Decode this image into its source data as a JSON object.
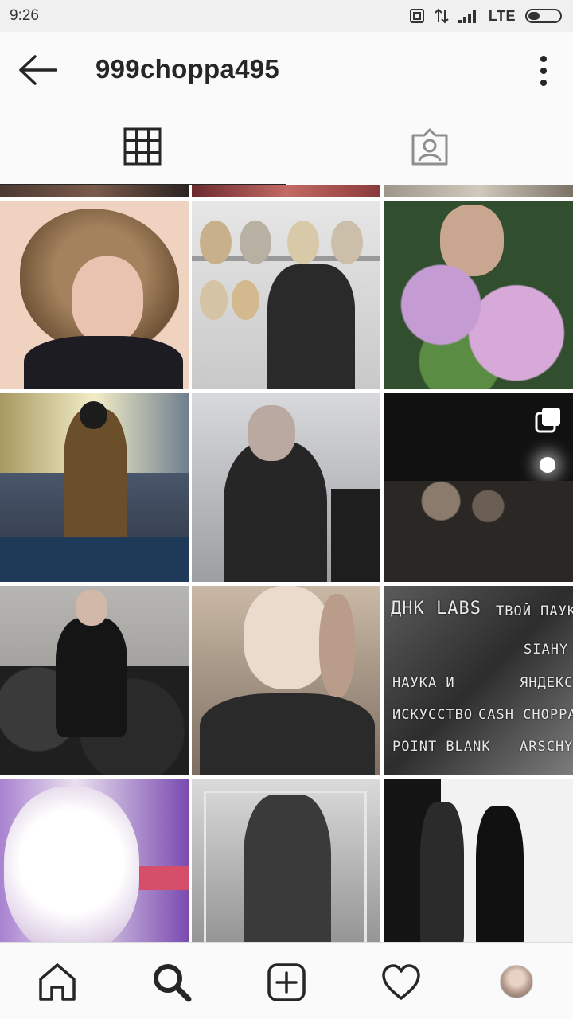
{
  "status_bar": {
    "time": "9:26",
    "network": "LTE",
    "icons": [
      "nfc-icon",
      "data-transfer-icon",
      "signal-icon",
      "battery-icon"
    ]
  },
  "header": {
    "title": "999choppa495",
    "back_icon": "arrow-left-icon",
    "more_icon": "more-vertical-icon"
  },
  "tabs": [
    {
      "icon": "grid-icon",
      "active": true
    },
    {
      "icon": "tagged-person-icon",
      "active": false
    }
  ],
  "posts": [
    {
      "row": 1,
      "col": 1,
      "scene": "portrait-messy-hair",
      "colors": [
        "#efd2c0",
        "#7a5a3c",
        "#1c1c22"
      ]
    },
    {
      "row": 1,
      "col": 2,
      "scene": "wig-store",
      "colors": [
        "#dcdcdc",
        "#a7a7a7",
        "#2a2a2a"
      ]
    },
    {
      "row": 1,
      "col": 3,
      "scene": "lilac-blur",
      "colors": [
        "#314e2e",
        "#b78bc3",
        "#7f6c5a"
      ]
    },
    {
      "row": 2,
      "col": 1,
      "scene": "masked-street",
      "colors": [
        "#3b4f6b",
        "#6a4f2a",
        "#a79960"
      ]
    },
    {
      "row": 2,
      "col": 2,
      "scene": "performer-smoke",
      "colors": [
        "#cfd0d3",
        "#585858",
        "#1e1e1e"
      ]
    },
    {
      "row": 2,
      "col": 3,
      "scene": "dark-crowd",
      "colors": [
        "#111111",
        "#3d3b3a",
        "#8a7b6c"
      ],
      "multiple": true
    },
    {
      "row": 3,
      "col": 1,
      "scene": "sitting-on-bags",
      "colors": [
        "#a3a29f",
        "#2a2a2a",
        "#6b6b6b"
      ]
    },
    {
      "row": 3,
      "col": 2,
      "scene": "close-up-portrait",
      "colors": [
        "#e7dccf",
        "#b99d8a",
        "#2a2a2a"
      ]
    },
    {
      "row": 3,
      "col": 3,
      "scene": "glitch-poster",
      "colors": [
        "#4a4a4a",
        "#9f9f9f",
        "#222222"
      ],
      "text_lines": [
        "ДНК LABS",
        "ТВОЙ ПАУК",
        "SIAHY",
        "ЯНДЕКС",
        "НАУКА И",
        "ИСКУССТВО",
        "CASH CHOPPA",
        "POINT BLANK",
        "ARSCHY"
      ]
    },
    {
      "row": 4,
      "col": 1,
      "scene": "overexposed-face",
      "colors": [
        "#f4eef6",
        "#c6a7d9",
        "#7a4bb0"
      ]
    },
    {
      "row": 4,
      "col": 2,
      "scene": "mirror-glitch",
      "colors": [
        "#c9c9c9",
        "#6a6a6a",
        "#2b2b2b"
      ]
    },
    {
      "row": 4,
      "col": 3,
      "scene": "bw-duo",
      "colors": [
        "#f2f2f2",
        "#9a9a9a",
        "#141414"
      ]
    }
  ],
  "bottom_nav": [
    {
      "name": "home",
      "icon": "home-icon"
    },
    {
      "name": "search",
      "icon": "search-icon",
      "active": true
    },
    {
      "name": "new-post",
      "icon": "plus-square-icon"
    },
    {
      "name": "activity",
      "icon": "heart-icon"
    },
    {
      "name": "profile",
      "icon": "avatar"
    }
  ]
}
